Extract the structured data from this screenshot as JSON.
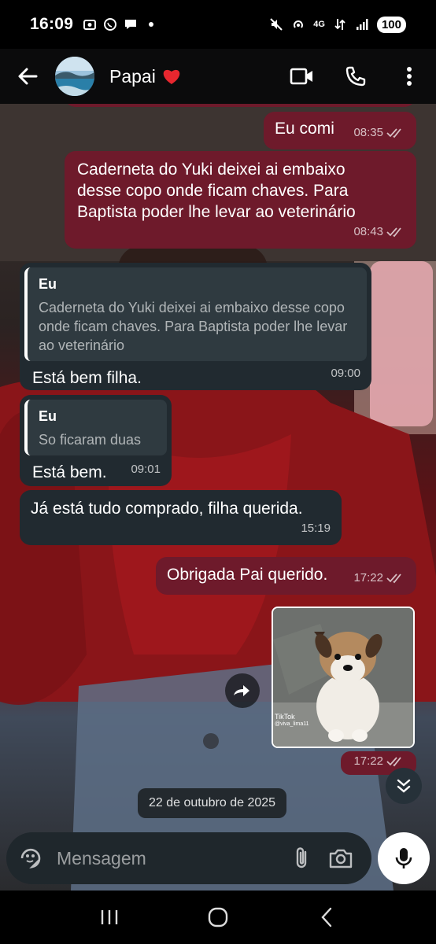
{
  "status_bar": {
    "time": "16:09",
    "network": "4G",
    "battery": "100",
    "icons": [
      "screenshot-icon",
      "whatsapp-icon",
      "chat-bubble-icon",
      "dot-icon",
      "mute-icon",
      "hotspot-icon",
      "data-arrows-icon",
      "signal-icon"
    ]
  },
  "header": {
    "contact_name": "Papai",
    "heart": "❤️",
    "actions": [
      "video-call-icon",
      "voice-call-icon",
      "more-options-icon"
    ]
  },
  "messages": [
    {
      "type": "outgoing",
      "text": "Eu comi",
      "time": "08:35",
      "read": true
    },
    {
      "type": "outgoing",
      "text": "Caderneta do Yuki deixei ai embaixo desse copo onde ficam chaves. Para Baptista poder lhe levar ao veterinário",
      "time": "08:43",
      "read": true
    },
    {
      "type": "incoming",
      "quote_author": "Eu",
      "quote_text": "Caderneta do Yuki deixei ai embaixo desse copo onde ficam chaves. Para Baptista poder lhe levar ao veterinário",
      "text": "Está bem filha.",
      "time": "09:00"
    },
    {
      "type": "incoming",
      "quote_author": "Eu",
      "quote_text": "So ficaram duas",
      "text": "Está bem.",
      "time": "09:01"
    },
    {
      "type": "incoming",
      "text": "Já está tudo comprado, filha querida.",
      "time": "15:19"
    },
    {
      "type": "outgoing",
      "text": "Obrigada Pai querido.",
      "time": "17:22",
      "read": true
    },
    {
      "type": "outgoing-media",
      "watermark": "TikTok",
      "watermark_user": "@viva_lima11",
      "time": "17:22",
      "read": true
    }
  ],
  "date_separator": "22 de outubro de 2025",
  "composer": {
    "placeholder": "Mensagem"
  },
  "colors": {
    "outgoing_bubble": "#6e1a2b",
    "incoming_bubble": "#212a30",
    "header_bg": "#0b0b0c"
  }
}
